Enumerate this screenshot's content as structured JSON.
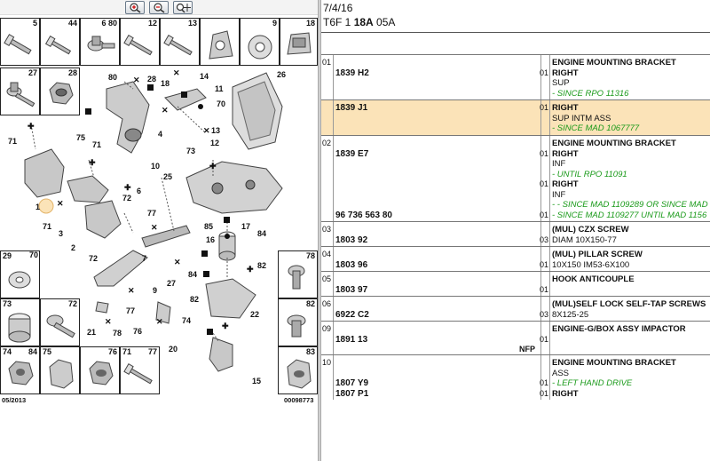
{
  "zoom_toolbar": {
    "icons": [
      "zoom-in-icon",
      "zoom-out-icon",
      "zoom-pan-icon"
    ]
  },
  "diagram": {
    "top_cells": [
      "5",
      "44",
      "6 80",
      "12",
      "13",
      "",
      "9",
      "18"
    ],
    "cells_row2": [
      "27",
      "28"
    ],
    "bottom_left_cells": [
      [
        "29",
        "70"
      ],
      [
        "73",
        "72"
      ],
      [
        "74",
        "84"
      ],
      [
        "75",
        "76"
      ],
      [
        "71",
        "77"
      ]
    ],
    "bottom_right_cells": [
      "78",
      "82",
      "83"
    ],
    "callouts": [
      "80",
      "28",
      "18",
      "14",
      "11",
      "26",
      "70",
      "4",
      "10",
      "13",
      "12",
      "71",
      "75",
      "71",
      "73",
      "25",
      "6",
      "1",
      "71",
      "3",
      "72",
      "2",
      "77",
      "85",
      "17",
      "16",
      "84",
      "82",
      "72",
      "9",
      "7",
      "27",
      "84",
      "82",
      "77",
      "22",
      "21",
      "78",
      "76",
      "20",
      "74",
      "15"
    ],
    "footer_left": "05/2013",
    "footer_right": "00098773"
  },
  "header": {
    "date": "7/4/16",
    "code_prefix": "T6F 1",
    "code_bold": "18A",
    "code_suffix": "05A"
  },
  "rows": [
    {
      "num": "01",
      "highlight": false,
      "lines": [
        {
          "ref": "",
          "qty": "",
          "desc": "ENGINE MOUNTING BRACKET",
          "style": "b"
        },
        {
          "ref": "1839 H2",
          "qty": "01",
          "desc": "RIGHT",
          "style": "b"
        },
        {
          "ref": "",
          "qty": "",
          "desc": "SUP",
          "style": ""
        },
        {
          "ref": "",
          "qty": "",
          "desc": "- SINCE RPO 11316",
          "style": "note"
        }
      ]
    },
    {
      "num": "",
      "highlight": true,
      "lines": [
        {
          "ref": "1839 J1",
          "qty": "01",
          "desc": "RIGHT",
          "style": "b"
        },
        {
          "ref": "",
          "qty": "",
          "desc": "SUP INTM ASS",
          "style": ""
        },
        {
          "ref": "",
          "qty": "",
          "desc": "- SINCE MAD 1067777",
          "style": "note"
        }
      ]
    },
    {
      "num": "02",
      "highlight": false,
      "lines": [
        {
          "ref": "",
          "qty": "",
          "desc": "ENGINE MOUNTING BRACKET",
          "style": "b"
        },
        {
          "ref": "1839 E7",
          "qty": "01",
          "desc": "RIGHT",
          "style": "b"
        },
        {
          "ref": "",
          "qty": "",
          "desc": "INF",
          "style": ""
        },
        {
          "ref": "",
          "qty": "",
          "desc": "- UNTIL RPO 11091",
          "style": "note"
        },
        {
          "ref": "",
          "qty": "01",
          "desc": "RIGHT",
          "style": "b"
        },
        {
          "ref": "",
          "qty": "",
          "desc": "INF",
          "style": ""
        },
        {
          "ref": "",
          "qty": "",
          "desc": "- - SINCE MAD 1109289 OR SINCE MAD",
          "style": "note"
        },
        {
          "ref": "96 736 563 80",
          "qty": "01",
          "desc": "- SINCE MAD 1109277 UNTIL MAD 1156",
          "style": "note"
        }
      ]
    },
    {
      "num": "03",
      "highlight": false,
      "lines": [
        {
          "ref": "",
          "qty": "",
          "desc": "(MUL) CZX SCREW",
          "style": "b"
        },
        {
          "ref": "1803 92",
          "qty": "03",
          "desc": "DIAM 10X150-77",
          "style": ""
        }
      ]
    },
    {
      "num": "04",
      "highlight": false,
      "lines": [
        {
          "ref": "",
          "qty": "",
          "desc": "(MUL) PILLAR SCREW",
          "style": "b"
        },
        {
          "ref": "1803 96",
          "qty": "01",
          "desc": "10X150 IM53-6X100",
          "style": ""
        }
      ]
    },
    {
      "num": "05",
      "highlight": false,
      "lines": [
        {
          "ref": "",
          "qty": "",
          "desc": "HOOK ANTICOUPLE",
          "style": "b"
        },
        {
          "ref": "1803 97",
          "qty": "01",
          "desc": "",
          "style": ""
        }
      ]
    },
    {
      "num": "06",
      "highlight": false,
      "lines": [
        {
          "ref": "",
          "qty": "",
          "desc": "(MUL)SELF LOCK SELF-TAP SCREWS",
          "style": "b"
        },
        {
          "ref": "6922 C2",
          "qty": "03",
          "desc": "8X125-25",
          "style": ""
        }
      ]
    },
    {
      "num": "09",
      "highlight": false,
      "nfp": "NFP",
      "lines": [
        {
          "ref": "",
          "qty": "",
          "desc": "ENGINE-G/BOX ASSY IMPACTOR",
          "style": "b"
        },
        {
          "ref": "1891 13",
          "qty": "01",
          "desc": "",
          "style": ""
        }
      ]
    },
    {
      "num": "10",
      "highlight": false,
      "lines": [
        {
          "ref": "",
          "qty": "",
          "desc": "ENGINE MOUNTING BRACKET",
          "style": "b"
        },
        {
          "ref": "",
          "qty": "",
          "desc": "ASS",
          "style": ""
        },
        {
          "ref": "1807 Y9",
          "qty": "01",
          "desc": "- LEFT HAND DRIVE",
          "style": "note"
        },
        {
          "ref": "1807 P1",
          "qty": "01",
          "desc": "RIGHT",
          "style": "b"
        }
      ]
    }
  ]
}
